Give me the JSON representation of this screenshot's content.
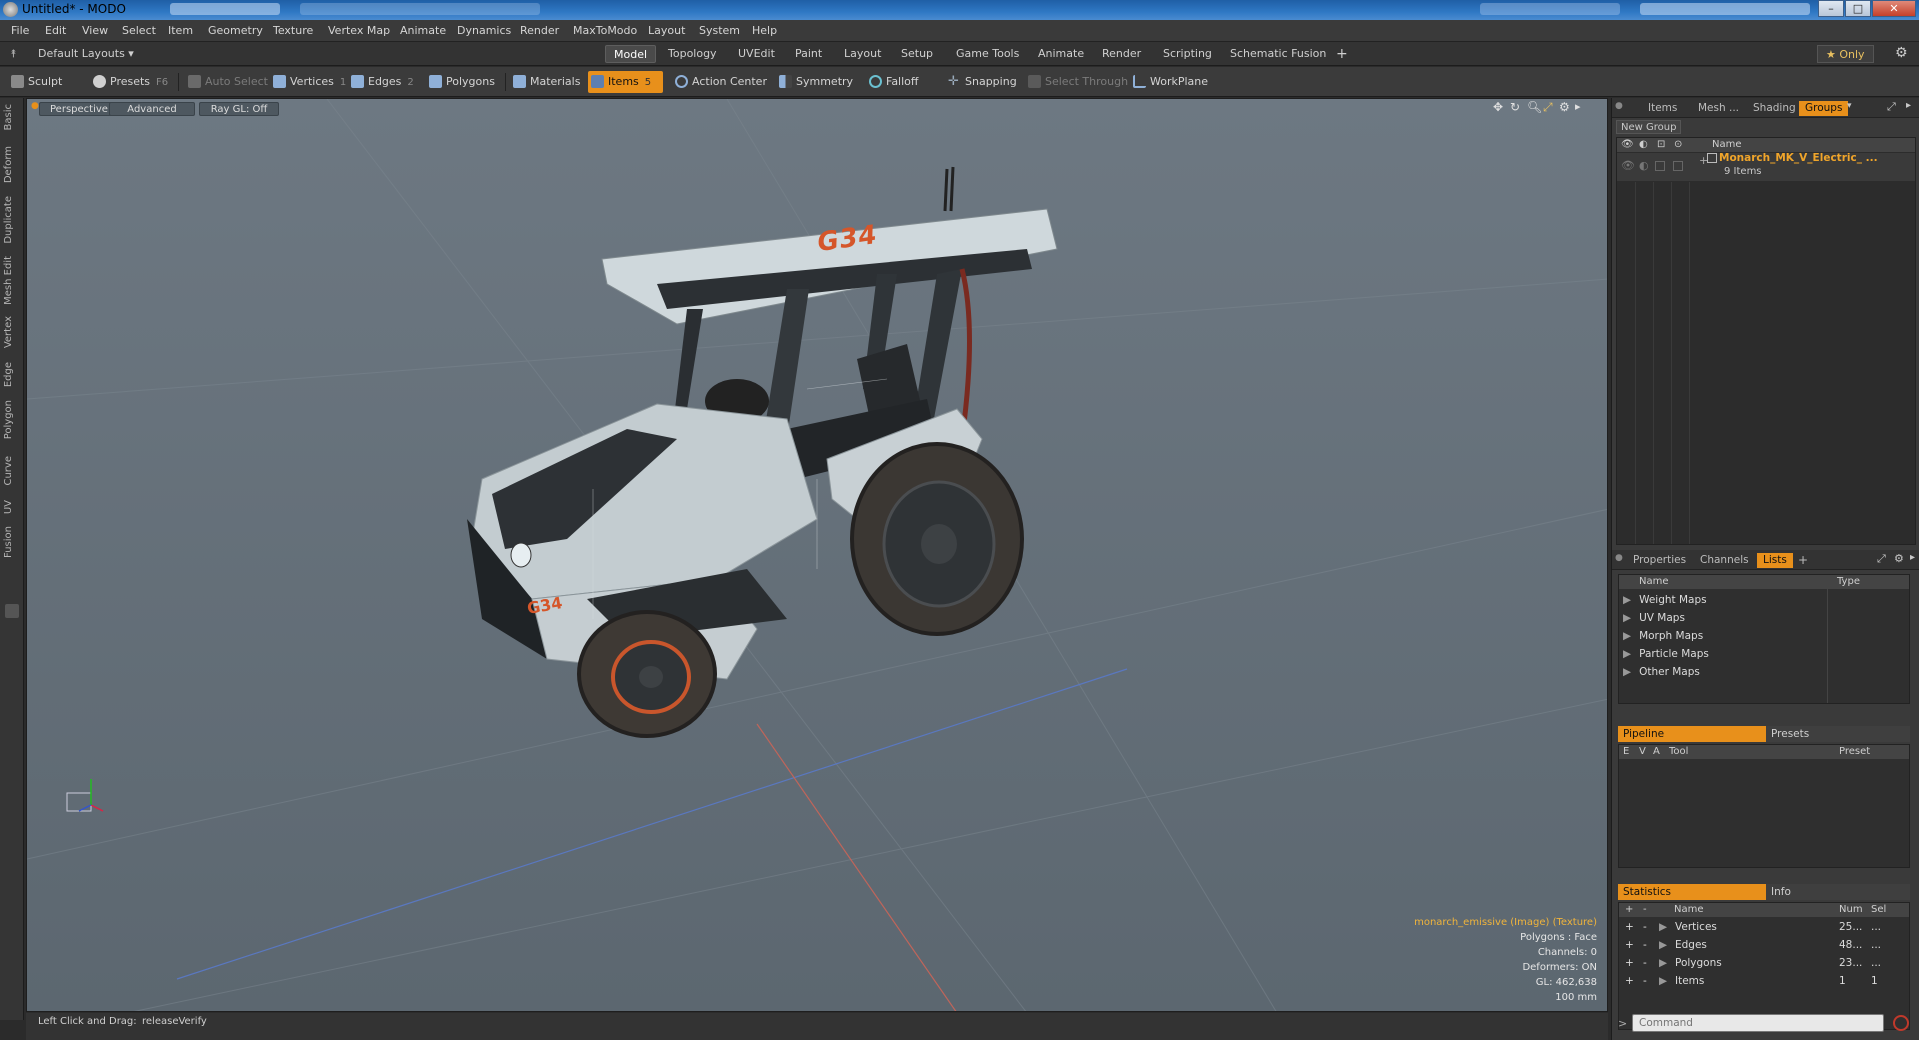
{
  "window": {
    "title": "Untitled* - MODO",
    "controls": {
      "minimize": "–",
      "maximize": "□",
      "close": "✕"
    }
  },
  "menu": [
    "File",
    "Edit",
    "View",
    "Select",
    "Item",
    "Geometry",
    "Texture",
    "Vertex Map",
    "Animate",
    "Dynamics",
    "Render",
    "MaxToModo",
    "Layout",
    "System",
    "Help"
  ],
  "layoutbar": {
    "layouts_dropdown": "Default Layouts ▾",
    "tabs": [
      "Model",
      "Topology",
      "UVEdit",
      "Paint",
      "Layout",
      "Setup",
      "Game Tools",
      "Animate",
      "Render",
      "Scripting",
      "Schematic Fusion"
    ],
    "active_tab": "Model",
    "add": "+",
    "only": "★ Only"
  },
  "toolbar": {
    "sculpt": "Sculpt",
    "presets": "Presets",
    "presets_key": "F6",
    "auto_select": "Auto Select",
    "vertices": "Vertices",
    "vertices_key": "1",
    "edges": "Edges",
    "edges_key": "2",
    "polygons": "Polygons",
    "materials": "Materials",
    "items": "Items",
    "items_key": "5",
    "action_center": "Action Center",
    "symmetry": "Symmetry",
    "falloff": "Falloff",
    "snapping": "Snapping",
    "select_through": "Select Through",
    "workplane": "WorkPlane"
  },
  "left_tabs": [
    "Basic",
    "Deform",
    "Duplicate",
    "Mesh Edit",
    "Vertex",
    "Edge",
    "Polygon",
    "Curve",
    "UV",
    "Fusion"
  ],
  "viewport": {
    "view": "Perspective",
    "shading": "Advanced",
    "raygl": "Ray GL: Off",
    "info": {
      "texture": "monarch_emissive (Image) (Texture)",
      "polygons": "Polygons : Face",
      "channels": "Channels: 0",
      "deformers": "Deformers: ON",
      "gl": "GL: 462,638",
      "scale": "100 mm"
    },
    "decal_top": "G34",
    "decal_side": "G34"
  },
  "status": {
    "label": "Left Click and Drag:",
    "action": "releaseVerify"
  },
  "items_panel": {
    "tabs": [
      "Items",
      "Mesh ...",
      "Shading",
      "Groups"
    ],
    "active_tab": "Groups",
    "new_group": "New Group",
    "name_header": "Name",
    "group_name": "Monarch_MK_V_Electric_ ...",
    "group_count": "9 Items"
  },
  "props_panel": {
    "tabs": [
      "Properties",
      "Channels",
      "Lists"
    ],
    "active_tab": "Lists",
    "add": "+",
    "headers": {
      "name": "Name",
      "type": "Type"
    },
    "rows": [
      "Weight Maps",
      "UV Maps",
      "Morph Maps",
      "Particle Maps",
      "Other Maps"
    ]
  },
  "pipeline_panel": {
    "tabs": [
      "Pipeline",
      "Presets"
    ],
    "headers": {
      "e": "E",
      "v": "V",
      "a": "A",
      "tool": "Tool",
      "preset": "Preset"
    }
  },
  "stats_panel": {
    "tabs": [
      "Statistics",
      "Info"
    ],
    "headers": {
      "plus": "+",
      "minus": "-",
      "name": "Name",
      "num": "Num",
      "sel": "Sel"
    },
    "rows": [
      {
        "plus": "+",
        "minus": "-",
        "name": "Vertices",
        "num": "25...",
        "sel": "..."
      },
      {
        "plus": "+",
        "minus": "-",
        "name": "Edges",
        "num": "48...",
        "sel": "..."
      },
      {
        "plus": "+",
        "minus": "-",
        "name": "Polygons",
        "num": "23...",
        "sel": "..."
      },
      {
        "plus": "+",
        "minus": "-",
        "name": "Items",
        "num": "1",
        "sel": "1"
      }
    ]
  },
  "command": {
    "placeholder": "Command"
  },
  "colors": {
    "accent": "#e8901b",
    "viewport_bg": "#66717b",
    "highlight_text": "#f0b43c"
  }
}
